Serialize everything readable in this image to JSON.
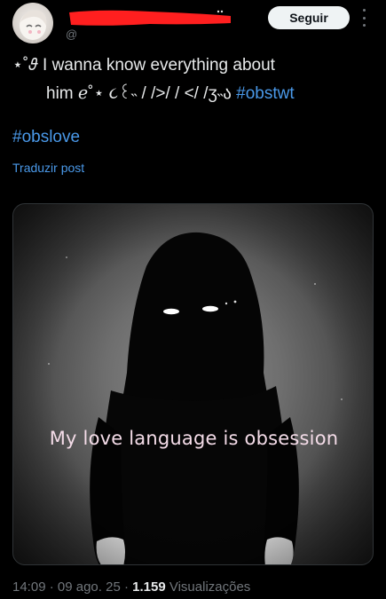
{
  "post": {
    "follow_label": "Seguir",
    "text_line1": "⋆˚𝜗 I wanna know everything about",
    "text_line2": "him ℯ˚⋆ ૮꒰˵ / />/ / </ /ʒ˵ა",
    "hashtag1": "#obstwt",
    "hashtag2": "#obslove",
    "translate_label": "Traduzir post",
    "media_caption": "My love language is obsession",
    "time": "14:09",
    "date": "09 ago. 25",
    "separator": "·",
    "views_count": "1.159",
    "views_label": "Visualizações"
  },
  "colors": {
    "background": "#000000",
    "link": "#4a99e9",
    "muted": "#71767b",
    "redaction": "#ff1f1f"
  },
  "icons": {
    "more": "more-vertical-icon"
  }
}
